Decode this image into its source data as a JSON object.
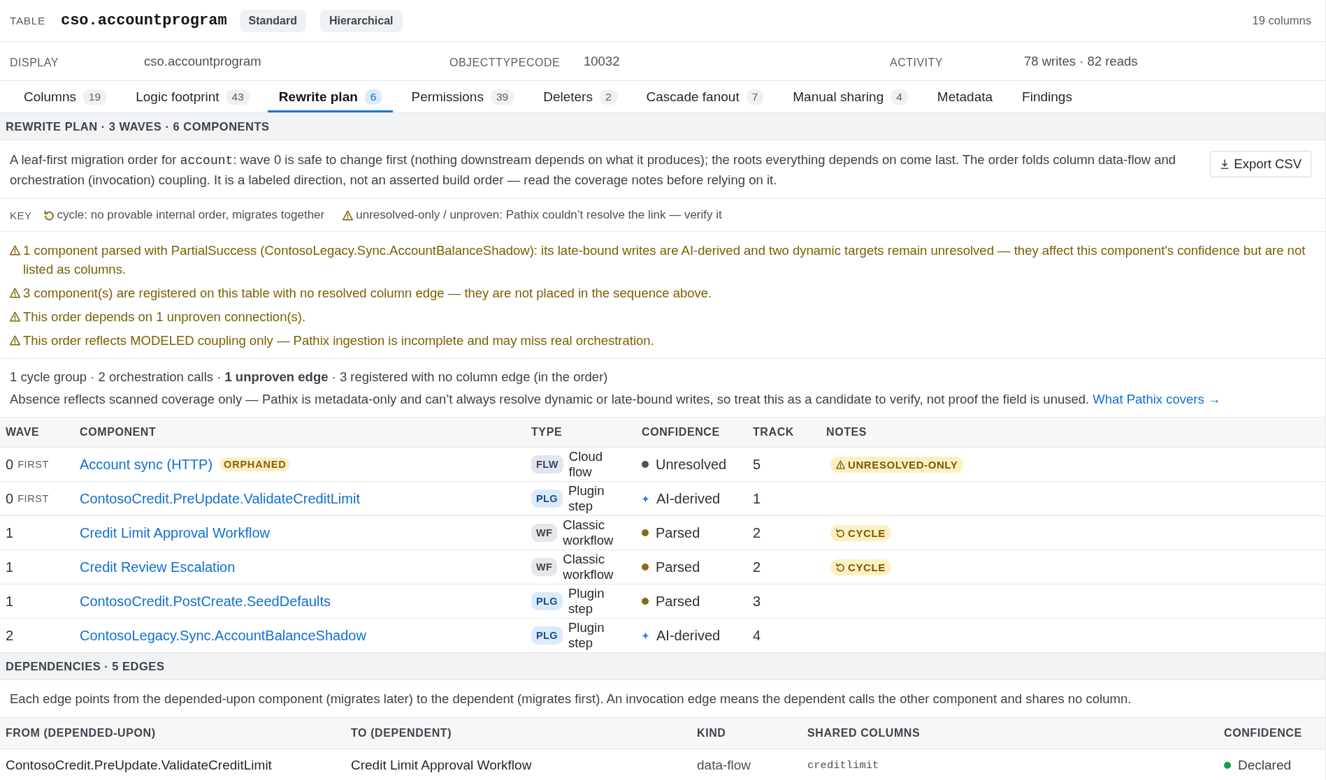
{
  "header": {
    "label": "TABLE",
    "title": "cso.accountprogram",
    "pills": [
      "Standard",
      "Hierarchical"
    ],
    "column_count": "19 columns"
  },
  "meta": [
    {
      "label": "DISPLAY",
      "value": "cso.accountprogram"
    },
    {
      "label": "OBJECTTYPECODE",
      "value": "10032"
    },
    {
      "label": "ACTIVITY",
      "value": "78 writes · 82 reads"
    }
  ],
  "tabs": [
    {
      "label": "Columns",
      "count": "19",
      "selected": false
    },
    {
      "label": "Logic footprint",
      "count": "43",
      "selected": false
    },
    {
      "label": "Rewrite plan",
      "count": "6",
      "selected": true
    },
    {
      "label": "Permissions",
      "count": "39",
      "selected": false
    },
    {
      "label": "Deleters",
      "count": "2",
      "selected": false
    },
    {
      "label": "Cascade fanout",
      "count": "7",
      "selected": false
    },
    {
      "label": "Manual sharing",
      "count": "4",
      "selected": false
    },
    {
      "label": "Metadata",
      "selected": false
    },
    {
      "label": "Findings",
      "selected": false
    }
  ],
  "rewrite_plan": {
    "heading": "REWRITE PLAN · 3 WAVES · 6 COMPONENTS",
    "description": [
      {
        "kind": "plain",
        "text": "A leaf-first migration order for "
      },
      {
        "kind": "code",
        "text": "account"
      },
      {
        "kind": "plain",
        "text": ": wave 0 is safe to change first (nothing downstream depends on what it produces); the roots everything depends on come last. The order folds column data-flow and orchestration (invocation) coupling. It is a labeled direction, not an asserted build order — read the coverage notes before relying on it."
      }
    ],
    "export_button": "Export CSV",
    "key": {
      "label": "KEY",
      "items": [
        {
          "kind": "cycle",
          "text": "cycle: no provable internal order, migrates together"
        },
        {
          "kind": "warning",
          "text": "unresolved-only / unproven: Pathix couldn’t resolve the link — verify it"
        }
      ]
    },
    "warnings": [
      "1 component parsed with PartialSuccess (ContosoLegacy.Sync.AccountBalanceShadow): its late-bound writes are AI-derived and two dynamic targets remain unresolved — they affect this component's confidence but are not listed as columns.",
      "3 component(s) are registered on this table with no resolved column edge — they are not placed in the sequence above.",
      "This order depends on 1 unproven connection(s).",
      "This order reflects MODELED coupling only — Pathix ingestion is incomplete and may miss real orchestration."
    ],
    "summary": "1 cycle group · 2 orchestration calls · **1 unproven edge** · 3 registered with no column edge (in the order)",
    "coverage_note": {
      "text": "Absence reflects scanned coverage only — Pathix is metadata-only and can’t always resolve dynamic or late-bound writes, so treat this as a candidate to verify, not proof the field is unused.",
      "link": "What Pathix covers →"
    },
    "table": {
      "columns": [
        "WAVE",
        "COMPONENT",
        "TYPE",
        "CONFIDENCE",
        "TRACK",
        "NOTES"
      ],
      "rows": [
        {
          "wave": "0",
          "wave_tag": "FIRST",
          "component": "Account sync (HTTP)",
          "tag": "ORPHANED",
          "type": {
            "kind": "flow",
            "badge": "FLW",
            "label": "Cloud flow"
          },
          "confidence": {
            "label": "Unresolved",
            "kind": "dot",
            "color": "#4b5260"
          },
          "track": "5",
          "note": {
            "kind": "unresolved",
            "label": "UNRESOLVED-ONLY"
          }
        },
        {
          "wave": "0",
          "wave_tag": "FIRST",
          "component": "ContosoCredit.PreUpdate.ValidateCreditLimit",
          "type": {
            "kind": "plugin",
            "badge": "PLG",
            "label": "Plugin step"
          },
          "confidence": {
            "label": "AI-derived",
            "kind": "sparkle",
            "color": "#2a7de1"
          },
          "track": "1"
        },
        {
          "wave": "1",
          "component": "Credit Limit Approval Workflow",
          "type": {
            "kind": "workflow",
            "badge": "WF",
            "label": "Classic workflow"
          },
          "confidence": {
            "label": "Parsed",
            "kind": "dot",
            "color": "#8a6a0c"
          },
          "track": "2",
          "note": {
            "kind": "cycle",
            "label": "CYCLE"
          }
        },
        {
          "wave": "1",
          "component": "Credit Review Escalation",
          "type": {
            "kind": "workflow",
            "badge": "WF",
            "label": "Classic workflow"
          },
          "confidence": {
            "label": "Parsed",
            "kind": "dot",
            "color": "#8a6a0c"
          },
          "track": "2",
          "note": {
            "kind": "cycle",
            "label": "CYCLE"
          }
        },
        {
          "wave": "1",
          "component": "ContosoCredit.PostCreate.SeedDefaults",
          "type": {
            "kind": "plugin",
            "badge": "PLG",
            "label": "Plugin step"
          },
          "confidence": {
            "label": "Parsed",
            "kind": "dot",
            "color": "#8a6a0c"
          },
          "track": "3"
        },
        {
          "wave": "2",
          "component": "ContosoLegacy.Sync.AccountBalanceShadow",
          "type": {
            "kind": "plugin",
            "badge": "PLG",
            "label": "Plugin step"
          },
          "confidence": {
            "label": "AI-derived",
            "kind": "sparkle",
            "color": "#2a7de1"
          },
          "track": "4"
        }
      ]
    }
  },
  "dependencies": {
    "heading": "DEPENDENCIES · 5 EDGES",
    "description": "Each edge points from the depended-upon component (migrates later) to the dependent (migrates first). An invocation edge means the dependent calls the other component and shares no column.",
    "table": {
      "columns": [
        "FROM (DEPENDED-UPON)",
        "TO (DEPENDENT)",
        "KIND",
        "SHARED COLUMNS",
        "CONFIDENCE"
      ],
      "rows": [
        {
          "from": "ContosoCredit.PreUpdate.ValidateCreditLimit",
          "to": "Credit Limit Approval Workflow",
          "edge_kind": "data-flow",
          "shared_columns": "creditlimit",
          "confidence": {
            "label": "Declared",
            "kind": "dot",
            "color": "#1f9d45"
          }
        }
      ]
    }
  }
}
